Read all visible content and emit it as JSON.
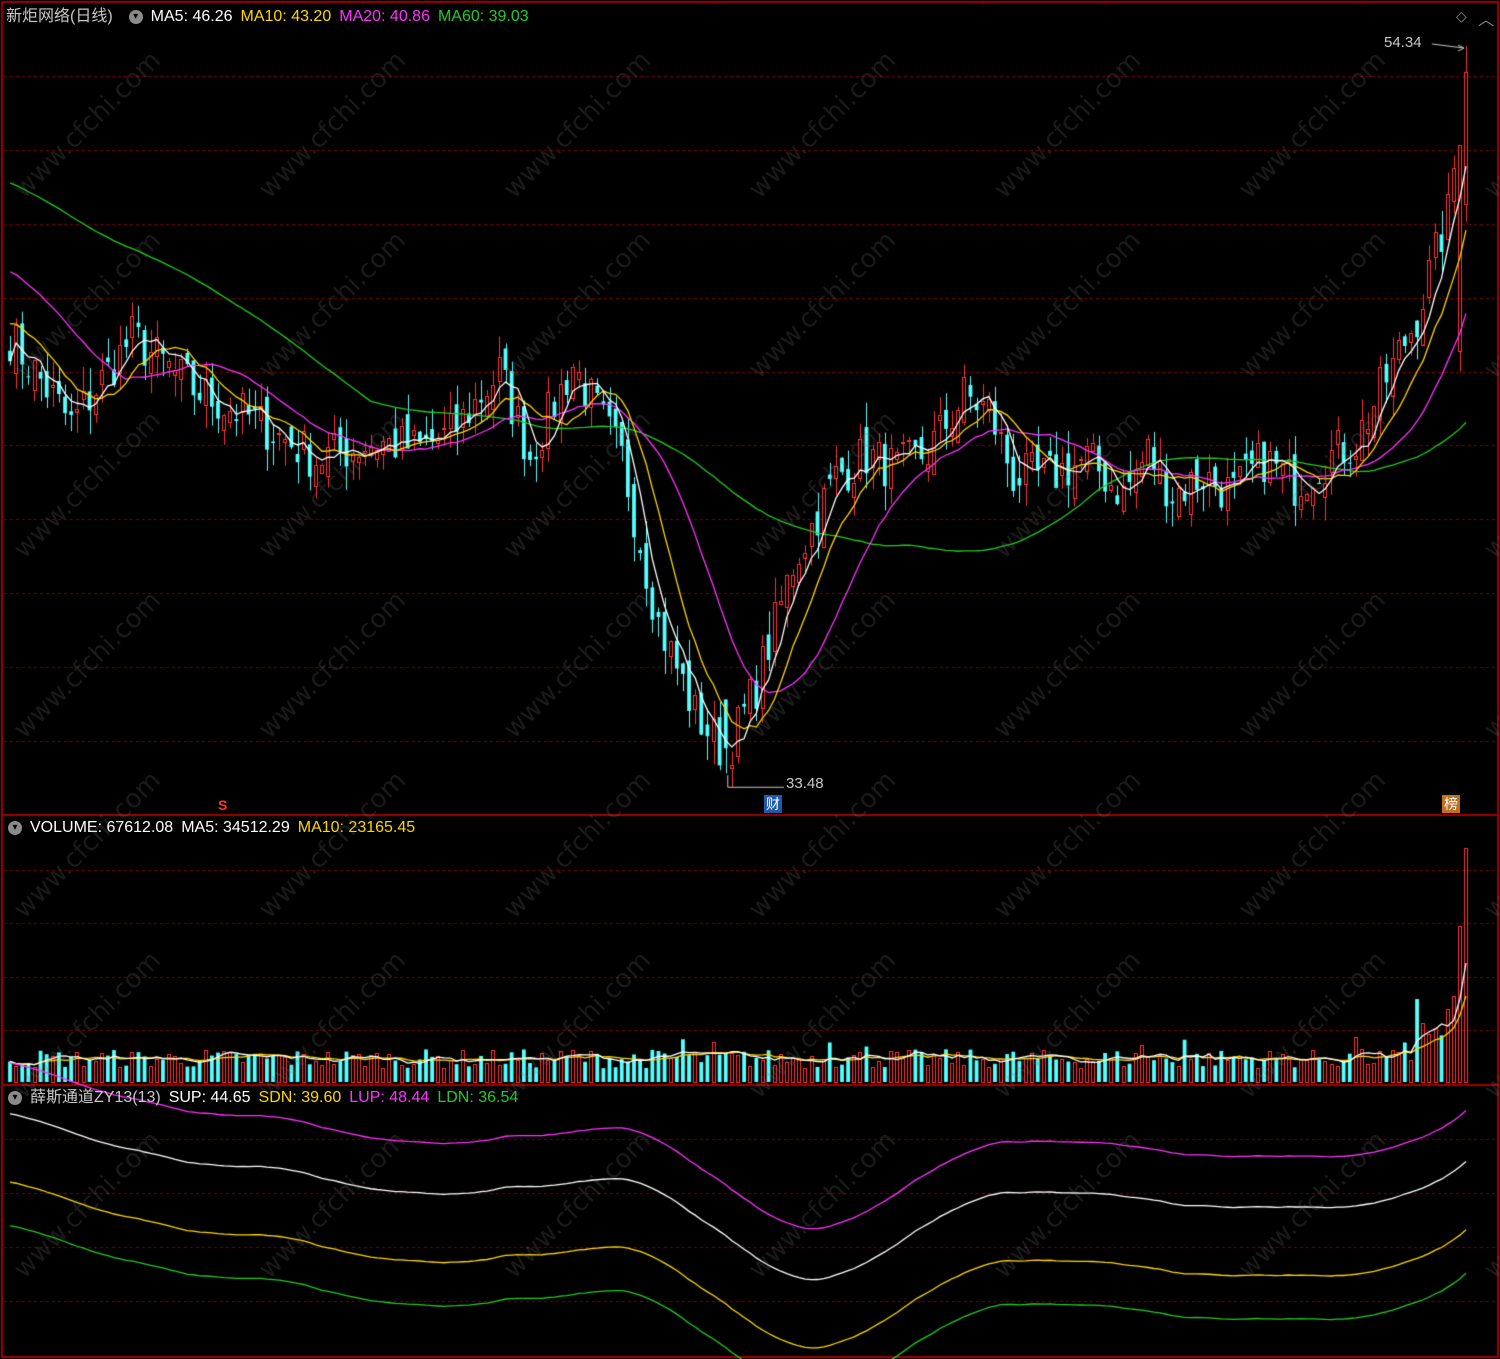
{
  "price_panel": {
    "title": "新炬网络(日线)",
    "ma5": "MA5: 46.26",
    "ma10": "MA10: 43.20",
    "ma20": "MA20: 40.86",
    "ma60": "MA60: 39.03",
    "high_label": "54.34",
    "low_label": "33.48",
    "badge_s": "S",
    "badge_cai": "财",
    "badge_bang": "榜"
  },
  "volume_panel": {
    "volume": "VOLUME: 67612.08",
    "ma5": "MA5: 34512.29",
    "ma10": "MA10: 23165.45"
  },
  "channel_panel": {
    "title": "薛斯通道ZY13(13)",
    "sup": "SUP: 44.65",
    "sdn": "SDN: 39.60",
    "lup": "LUP: 48.44",
    "ldn": "LDN: 36.54"
  },
  "watermark": "www.cfchi.com",
  "colors": {
    "up": "#ff3232",
    "down": "#54ffff",
    "ma5": "#ffffff",
    "ma10": "#ffd700",
    "ma20": "#ff33ff",
    "ma60": "#22cc22",
    "grid": "#7a0000",
    "border": "#a00000"
  },
  "chart_data": [
    {
      "type": "candlestick",
      "title": "新炬网络(日线)",
      "approx_close_anchors": [
        [
          0,
          46.0
        ],
        [
          10,
          43.5
        ],
        [
          20,
          46.0
        ],
        [
          30,
          44.5
        ],
        [
          40,
          43.6
        ],
        [
          50,
          42.5
        ],
        [
          60,
          43.0
        ],
        [
          67,
          42.8
        ],
        [
          72,
          43.2
        ],
        [
          80,
          45.0
        ],
        [
          85,
          42.6
        ],
        [
          92,
          45.2
        ],
        [
          100,
          42.5
        ],
        [
          106,
          37.8
        ],
        [
          112,
          35.2
        ],
        [
          117,
          34.0
        ],
        [
          122,
          36.0
        ],
        [
          128,
          39.5
        ],
        [
          135,
          42.0
        ],
        [
          140,
          42.6
        ],
        [
          145,
          42.2
        ],
        [
          150,
          42.7
        ],
        [
          156,
          44.3
        ],
        [
          160,
          43.9
        ],
        [
          164,
          42.0
        ],
        [
          170,
          42.0
        ],
        [
          176,
          42.5
        ],
        [
          182,
          41.5
        ],
        [
          186,
          42.7
        ],
        [
          190,
          41.5
        ],
        [
          195,
          42.0
        ],
        [
          200,
          41.5
        ],
        [
          205,
          42.5
        ],
        [
          210,
          41.8
        ],
        [
          215,
          42.5
        ],
        [
          220,
          43.0
        ],
        [
          225,
          44.8
        ],
        [
          230,
          46.6
        ],
        [
          235,
          49.5
        ],
        [
          238,
          53.5
        ]
      ],
      "high": 54.34,
      "low": 33.48,
      "ma_last": {
        "MA5": 46.26,
        "MA10": 43.2,
        "MA20": 40.86,
        "MA60": 39.03
      }
    },
    {
      "type": "bar",
      "title": "VOLUME",
      "last": 67612.08,
      "ma_last": {
        "MA5": 34512.29,
        "MA10": 23165.45
      }
    },
    {
      "type": "line",
      "title": "薛斯通道ZY13(13)",
      "series_last": {
        "SUP": 44.65,
        "SDN": 39.6,
        "LUP": 48.44,
        "LDN": 36.54
      }
    }
  ]
}
